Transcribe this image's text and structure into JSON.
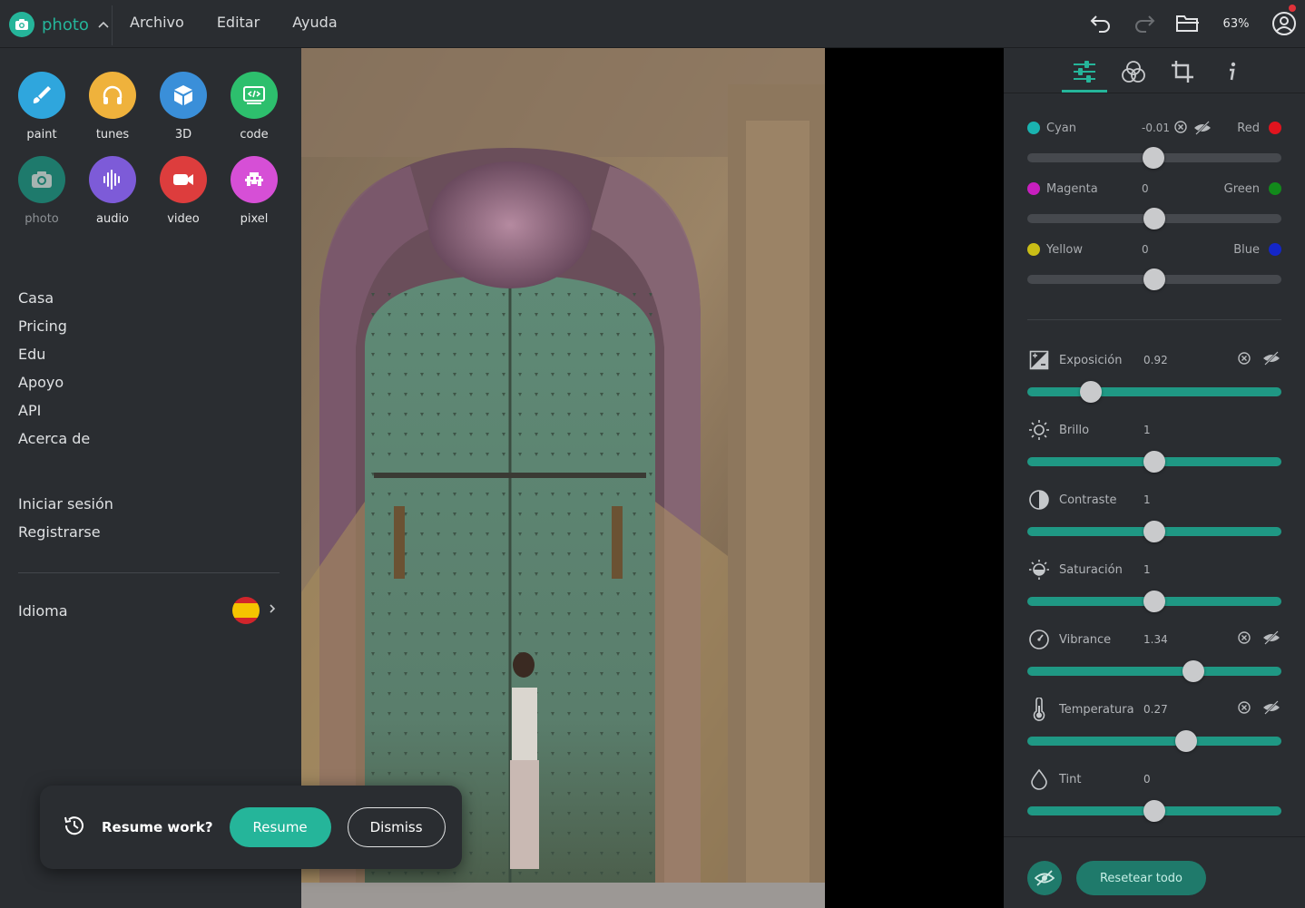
{
  "app": {
    "name": "photo",
    "zoom": "63%"
  },
  "menu": [
    "Archivo",
    "Editar",
    "Ayuda"
  ],
  "apps": [
    {
      "label": "paint",
      "color": "#2fa6dd",
      "icon": "brush-icon"
    },
    {
      "label": "tunes",
      "color": "#efb23c",
      "icon": "headphones-icon"
    },
    {
      "label": "3D",
      "color": "#3a8fd9",
      "icon": "cube-icon"
    },
    {
      "label": "code",
      "color": "#2dbf6d",
      "icon": "code-icon"
    },
    {
      "label": "photo",
      "color": "#1e7a6c",
      "icon": "camera-icon"
    },
    {
      "label": "audio",
      "color": "#7d5bd8",
      "icon": "waveform-icon"
    },
    {
      "label": "video",
      "color": "#dd3d3d",
      "icon": "video-icon"
    },
    {
      "label": "pixel",
      "color": "#d64fd6",
      "icon": "invader-icon"
    }
  ],
  "nav": [
    "Casa",
    "Pricing",
    "Edu",
    "Apoyo",
    "API",
    "Acerca de"
  ],
  "account": [
    "Iniciar sesión",
    "Registrarse"
  ],
  "language": {
    "label": "Idioma",
    "flag": "spain-flag-icon"
  },
  "resume": {
    "question": "Resume work?",
    "resume_label": "Resume",
    "dismiss_label": "Dismiss"
  },
  "color_balance": [
    {
      "left": "Cyan",
      "left_color": "#1ab3b0",
      "right": "Red",
      "right_color": "#e0141e",
      "value": "-0.01",
      "level": -0.01
    },
    {
      "left": "Magenta",
      "left_color": "#c81fbf",
      "right": "Green",
      "right_color": "#128a1b",
      "value": "0",
      "level": 0
    },
    {
      "left": "Yellow",
      "left_color": "#c9bd16",
      "right": "Blue",
      "right_color": "#1426c8",
      "value": "0",
      "level": 0
    }
  ],
  "adjustments": [
    {
      "label": "Exposición",
      "value": "0.92",
      "fraction": 0.25,
      "icon": "exposure-icon",
      "modified": true
    },
    {
      "label": "Brillo",
      "value": "1",
      "fraction": 0.5,
      "icon": "sun-icon",
      "modified": false
    },
    {
      "label": "Contraste",
      "value": "1",
      "fraction": 0.5,
      "icon": "contrast-icon",
      "modified": false
    },
    {
      "label": "Saturación",
      "value": "1",
      "fraction": 0.5,
      "icon": "saturation-icon",
      "modified": false
    },
    {
      "label": "Vibrance",
      "value": "1.34",
      "fraction": 0.655,
      "icon": "vibrance-icon",
      "modified": true
    },
    {
      "label": "Temperatura",
      "value": "0.27",
      "fraction": 0.625,
      "icon": "thermometer-icon",
      "modified": true
    },
    {
      "label": "Tint",
      "value": "0",
      "fraction": 0.5,
      "icon": "drop-icon",
      "modified": false
    }
  ],
  "reset_label": "Resetear todo"
}
